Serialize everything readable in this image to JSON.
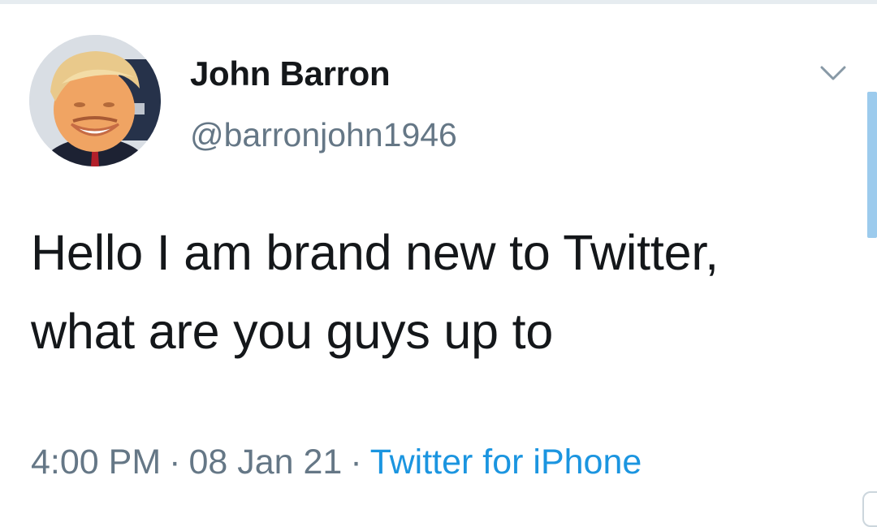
{
  "tweet": {
    "author_name": "John Barron",
    "author_handle": "@barronjohn1946",
    "text": "Hello I am brand new to Twitter, what are you guys up to",
    "time": "4:00 PM",
    "separator": "·",
    "date": "08 Jan 21",
    "source": "Twitter for iPhone"
  },
  "icons": {
    "menu": "chevron-down-icon",
    "avatar": "avatar-image"
  },
  "colors": {
    "text_primary": "#14171a",
    "text_secondary": "#657786",
    "link": "#1b95e0",
    "scrollbar": "#9ccbed"
  }
}
